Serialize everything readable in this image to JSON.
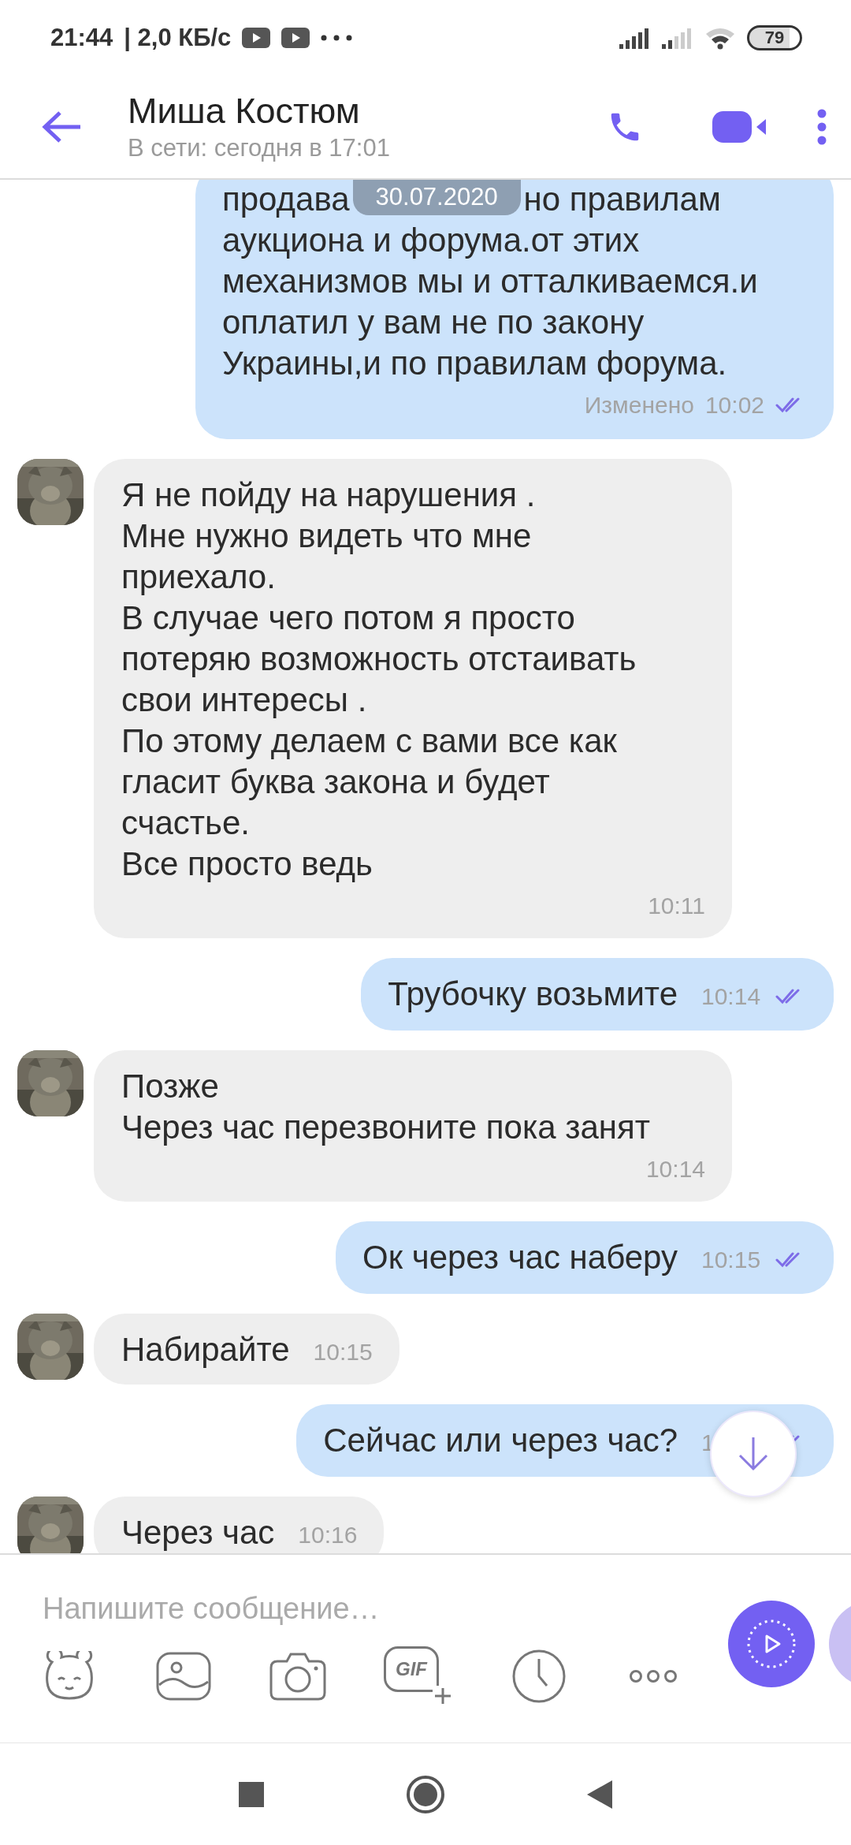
{
  "status_bar": {
    "time": "21:44",
    "speed": "| 2,0 КБ/с",
    "battery": "79"
  },
  "header": {
    "title": "Миша Костюм",
    "subtitle": "В сети: сегодня в 17:01"
  },
  "date_chip": "30.07.2020",
  "messages": [
    {
      "kind": "outgoing",
      "covered_line": [
        "продава",
        "но правилам"
      ],
      "text": "аукциона и форума.от этих\nмеханизмов мы и отталкиваемся.и\nоплатил у вам не по закону\nУкраины,и по правилам форума.",
      "edited": "Изменено",
      "time": "10:02",
      "read": true
    },
    {
      "kind": "incoming",
      "text": "Я не пойду на нарушения .\nМне нужно видеть что мне\nприехало.\nВ случае чего потом я просто\nпотеряю возможность отстаивать\nсвои интересы .\nПо этому делаем с вами все как\nгласит буква закона и будет\nсчастье.\nВсе просто ведь",
      "time": "10:11"
    },
    {
      "kind": "outgoing",
      "text": "Трубочку возьмите",
      "time": "10:14",
      "read": true
    },
    {
      "kind": "incoming",
      "text": "Позже\nЧерез час перезвоните пока занят",
      "time": "10:14"
    },
    {
      "kind": "outgoing",
      "text": "Ок через час наберу",
      "time": "10:15",
      "read": true
    },
    {
      "kind": "incoming",
      "text": "Набирайте",
      "time": "10:15"
    },
    {
      "kind": "outgoing",
      "text": "Сейчас или через час?",
      "time": "1",
      "read": true
    },
    {
      "kind": "incoming",
      "text": "Через час",
      "time": "10:16"
    }
  ],
  "composer": {
    "placeholder": "Напишите сообщение…",
    "gif_label": "GIF"
  }
}
